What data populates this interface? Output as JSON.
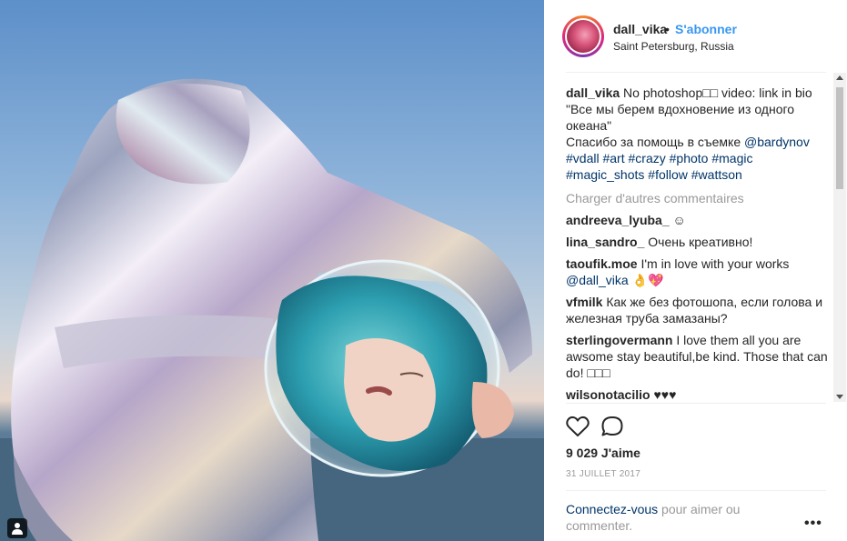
{
  "header": {
    "username": "dall_vika",
    "dot": "•",
    "follow_label": "S'abonner",
    "location": "Saint Petersburg, Russia"
  },
  "caption": {
    "username": "dall_vika",
    "text_1": "No photoshop□□ video: link in bio \"Все мы берем вдохновение из одного океана\"",
    "text_2": "Спасибо за помощь в съемке ",
    "mention": "@bardynov",
    "hashtags": [
      "#vdall",
      "#art",
      "#crazy",
      "#photo",
      "#magic",
      "#magic_shots",
      "#follow",
      "#wattson"
    ]
  },
  "load_more_label": "Charger d'autres commentaires",
  "comments": [
    {
      "user": "andreeva_lyuba_",
      "text": "☺"
    },
    {
      "user": "lina_sandro_",
      "text": "Очень креативно!"
    },
    {
      "user": "taoufik.moe",
      "text": "I'm in love with your works ",
      "mention": "@dall_vika",
      "suffix": " 👌💖"
    },
    {
      "user": "vfmilk",
      "text": "Как же без фотошопа, если голова и железная труба замазаны?"
    },
    {
      "user": "sterlingovermann",
      "text": "I love them all you are awsome stay beautiful,be kind. Those that can do! □□□"
    },
    {
      "user": "wilsonotacilio",
      "text": "♥♥♥"
    }
  ],
  "actions": {
    "like_icon": "heart-icon",
    "comment_icon": "comment-icon"
  },
  "likes_label": "9 029 J'aime",
  "date_label": "31 JUILLET 2017",
  "login": {
    "link": "Connectez-vous",
    "text": " pour aimer ou commenter."
  },
  "more_label": "•••",
  "colors": {
    "accent": "#3897f0",
    "link": "#003569",
    "muted": "#999999"
  }
}
